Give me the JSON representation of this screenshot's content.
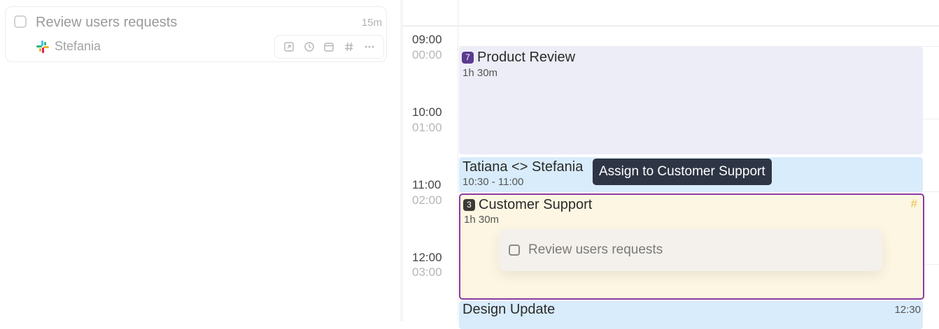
{
  "task": {
    "title": "Review users requests",
    "duration": "15m",
    "assignee": "Stefania",
    "source_icon": "slack-icon",
    "actions": [
      "open-external-icon",
      "clock-icon",
      "calendar-icon",
      "hashtag-icon",
      "more-icon"
    ]
  },
  "calendar": {
    "time_labels": [
      {
        "primary": "09:00",
        "secondary": "00:00"
      },
      {
        "primary": "10:00",
        "secondary": "01:00"
      },
      {
        "primary": "11:00",
        "secondary": "02:00"
      },
      {
        "primary": "12:00",
        "secondary": "03:00"
      }
    ],
    "events": {
      "product_review": {
        "badge": "7",
        "badge_color": "#5b3a8e",
        "title": "Product Review",
        "subtitle": "1h 30m",
        "color": "#ededf8"
      },
      "tatiana_stefania": {
        "title": "Tatiana <> Stefania",
        "subtitle": "10:30 - 11:00",
        "color": "#d8ecfb"
      },
      "customer_support": {
        "badge": "3",
        "badge_color": "#3d3a35",
        "title": "Customer Support",
        "subtitle": "1h 30m",
        "hash": "#",
        "color": "#fdf6e2",
        "border_color": "#8b3aa0"
      },
      "design_update": {
        "title": "Design Update",
        "time": "12:30",
        "color": "#d8ecfb"
      }
    },
    "drop_item": {
      "title": "Review users requests"
    }
  },
  "tooltip": {
    "text": "Assign to Customer Support"
  }
}
